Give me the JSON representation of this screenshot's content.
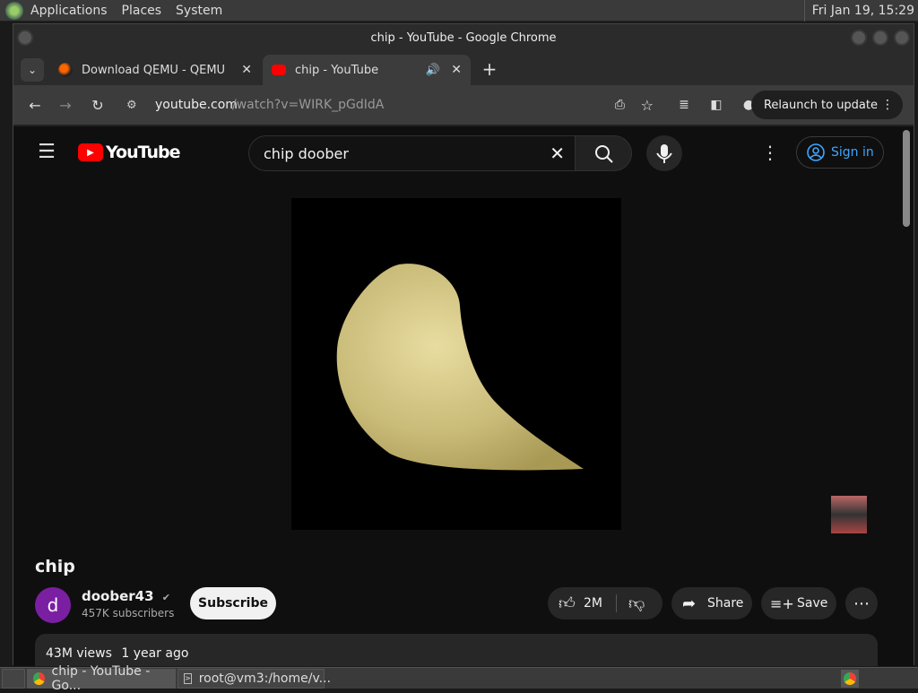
{
  "desktop": {
    "menu": [
      "Applications",
      "Places",
      "System"
    ],
    "clock": "Fri Jan 19, 15:29"
  },
  "window": {
    "title": "chip - YouTube - Google Chrome"
  },
  "tabs": [
    {
      "label": "Download QEMU - QEMU"
    },
    {
      "label": "chip - YouTube"
    }
  ],
  "navbar": {
    "url_host": "youtube.com",
    "url_path": "/watch?v=WIRK_pGdIdA",
    "relaunch": "Relaunch to update"
  },
  "youtube": {
    "logo_text": "YouTube",
    "search_value": "chip doober",
    "sign_in": "Sign in",
    "video_title": "chip",
    "channel_initial": "d",
    "channel_name": "doober43",
    "subscribers": "457K subscribers",
    "subscribe": "Subscribe",
    "likes": "2M",
    "share": "Share",
    "save": "Save",
    "views": "43M views",
    "age": "1 year ago"
  },
  "taskbar": {
    "items": [
      "chip - YouTube - Go...",
      "root@vm3:/home/v..."
    ]
  },
  "colors": {
    "youtube_red": "#ff0000",
    "link_blue": "#3ea6ff",
    "avatar_purple": "#7b1fa2"
  }
}
